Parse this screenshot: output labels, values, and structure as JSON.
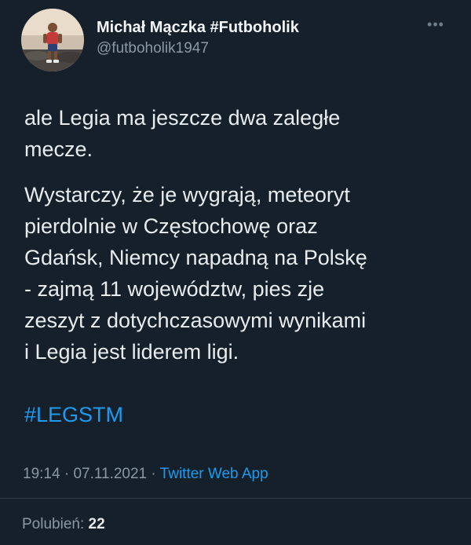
{
  "author": {
    "display_name": "Michał Mączka #Futboholik",
    "handle": "@futboholik1947"
  },
  "icons": {
    "more": "more-options-icon"
  },
  "tweet": {
    "paragraphs": [
      "ale Legia ma jeszcze dwa zaległe\nmecze.",
      "Wystarczy, że je wygrają, meteoryt\npierdolnie w Częstochowę oraz\nGdańsk, Niemcy napadną na Polskę\n- zajmą 11 województw, pies zje\nzeszyt z dotychczasowymi wynikami\ni Legia jest liderem ligi."
    ],
    "hashtag": "#LEGSTM"
  },
  "meta": {
    "time": "19:14",
    "separator": " · ",
    "date": "07.11.2021",
    "app": "Twitter Web App"
  },
  "likes": {
    "label": "Polubień: ",
    "count": "22"
  },
  "colors": {
    "background": "#15202b",
    "accent": "#1d9bf0",
    "muted": "#8b98a5"
  }
}
